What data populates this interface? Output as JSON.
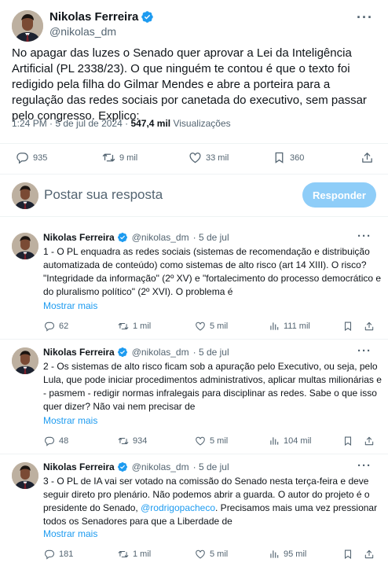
{
  "main": {
    "name": "Nikolas Ferreira",
    "handle": "@nikolas_dm",
    "text": "No apagar das luzes o Senado quer aprovar a Lei da Inteligência Artificial (PL 2338/23). O que ninguém te contou é que o texto foi redigido pela filha do Gilmar Mendes e abre a porteira para a regulação das redes sociais por canetada do executivo, sem passar pelo congresso. Explico:",
    "time": "1:24 PM · 5 de jul de 2024 · ",
    "views_count": "547,4 mil",
    "views_label": " Visualizações",
    "replies": "935",
    "retweets": "9 mil",
    "likes": "33 mil",
    "bookmarks": "360"
  },
  "reply_box": {
    "placeholder": "Postar sua resposta",
    "button": "Responder"
  },
  "replies": [
    {
      "name": "Nikolas Ferreira",
      "handle": "@nikolas_dm",
      "date": "· 5 de jul",
      "text": "1 - O PL enquadra as redes sociais (sistemas de recomendação e distribuição automatizada de conteúdo) como sistemas de alto risco (art 14 XIII). O risco? \"Integridade da informação\" (2º XV) e \"fortalecimento do processo democrático e do pluralismo político\" (2º XVI). O problema é",
      "show_more": "Mostrar mais",
      "replies": "62",
      "retweets": "1 mil",
      "likes": "5 mil",
      "views": "111 mil"
    },
    {
      "name": "Nikolas Ferreira",
      "handle": "@nikolas_dm",
      "date": "· 5 de jul",
      "text": "2 - Os sistemas de alto risco ficam sob a apuração pelo Executivo, ou seja, pelo Lula, que pode iniciar procedimentos administrativos, aplicar multas milionárias e - pasmem - redigir normas infralegais para disciplinar as redes. Sabe o que isso quer dizer? Não vai nem precisar de",
      "show_more": "Mostrar mais",
      "replies": "48",
      "retweets": "934",
      "likes": "5 mil",
      "views": "104 mil"
    },
    {
      "name": "Nikolas Ferreira",
      "handle": "@nikolas_dm",
      "date": "· 5 de jul",
      "text_before": "3 - O PL de IA vai ser votado na comissão do Senado nesta terça-feira e deve seguir direto pro plenário. Não podemos abrir a guarda. O autor do projeto é o presidente do Senado, ",
      "mention": "@rodrigopacheco",
      "text_after": ". Precisamos mais uma vez pressionar todos os Senadores para que a Liberdade de",
      "show_more": "Mostrar mais",
      "replies": "181",
      "retweets": "1 mil",
      "likes": "5 mil",
      "views": "95 mil"
    }
  ],
  "icons": [
    "more-icon",
    "verified-icon",
    "reply-icon",
    "retweet-icon",
    "like-icon",
    "bookmark-icon",
    "views-icon",
    "share-icon"
  ],
  "colors": {
    "accent": "#1d9bf0",
    "button_disabled": "#8ecdf8",
    "muted": "#536471",
    "text": "#0f1419"
  }
}
